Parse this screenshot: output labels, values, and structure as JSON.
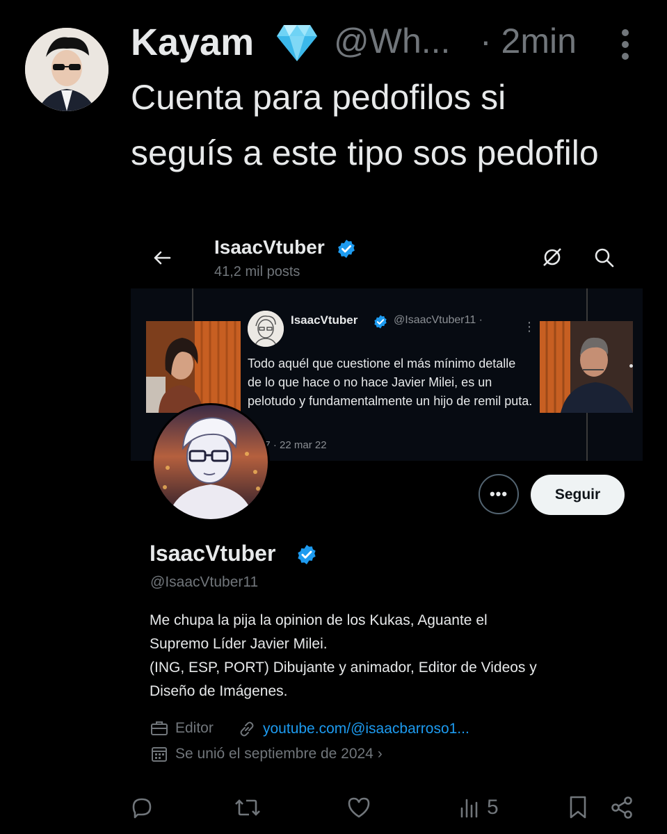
{
  "tweet": {
    "author_name": "Kayam",
    "author_badge_icon": "diamond-icon",
    "author_handle": "@Wh...",
    "time": "· 2min",
    "text": "Cuenta para pedofilos si seguís a este tipo sos pedofilo"
  },
  "embedded": {
    "header_title": "IsaacVtuber",
    "header_posts": "41,2 mil posts",
    "banner_tweet": {
      "name": "IsaacVtuber",
      "handle": "@IsaacVtuber11 ·",
      "text": "Todo aquél que cuestione el más mínimo detalle de lo que hace o no hace Javier Milei, es un pelotudo y fundamentalmente un hijo de remil puta.",
      "date": "27 · 22 mar 22"
    },
    "more_button": "•••",
    "follow_button": "Seguir",
    "profile": {
      "name": "IsaacVtuber",
      "handle": "@IsaacVtuber11",
      "bio": [
        "Me chupa la pija la opinion de los Kukas, Aguante el",
        "Supremo Líder Javier Milei.",
        "(ING, ESP, PORT) Dibujante y animador, Editor de Videos y",
        "Diseño de Imágenes."
      ],
      "job": "Editor",
      "link": "youtube.com/@isaacbarroso1...",
      "joined": "Se unió el septiembre de 2024 ›"
    }
  },
  "actions": {
    "views": "5"
  },
  "colors": {
    "background": "#000000",
    "text": "#e7e9ea",
    "muted": "#71767b",
    "link": "#1d9bf0",
    "verified": "#1d9bf0",
    "follow_bg": "#eff3f4"
  }
}
